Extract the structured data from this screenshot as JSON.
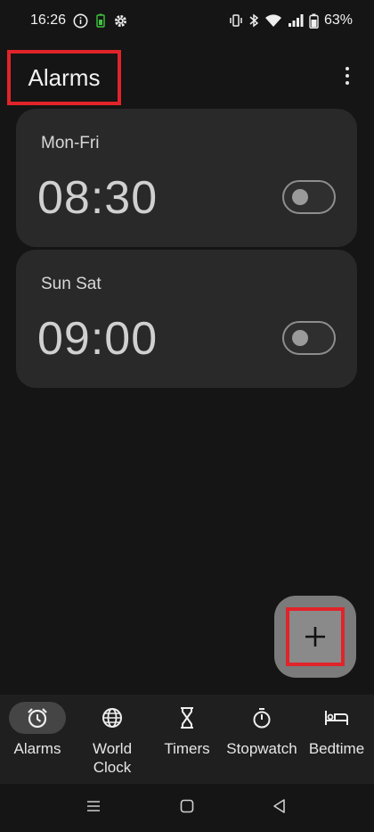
{
  "status_bar": {
    "time": "16:26",
    "battery_percent": "63%",
    "icons_left": [
      "info-icon",
      "battery-saver-icon",
      "settings-gear-icon"
    ],
    "icons_right": [
      "vibrate-icon",
      "bluetooth-icon",
      "wifi-icon",
      "signal-icon",
      "battery-icon"
    ]
  },
  "app_bar": {
    "title": "Alarms",
    "menu_icon": "more-vert-icon"
  },
  "alarms": [
    {
      "days": "Mon-Fri",
      "time": "08:30",
      "enabled": false
    },
    {
      "days": "Sun Sat",
      "time": "09:00",
      "enabled": false
    }
  ],
  "fab": {
    "icon": "plus-icon"
  },
  "bottom_nav": {
    "items": [
      {
        "label": "Alarms",
        "icon": "alarm-clock-icon",
        "active": true
      },
      {
        "label": "World Clock",
        "icon": "globe-icon",
        "active": false
      },
      {
        "label": "Timers",
        "icon": "hourglass-icon",
        "active": false
      },
      {
        "label": "Stopwatch",
        "icon": "stopwatch-icon",
        "active": false
      },
      {
        "label": "Bedtime",
        "icon": "bed-icon",
        "active": false
      }
    ]
  },
  "system_nav": [
    "recents-icon",
    "home-icon",
    "back-icon"
  ],
  "colors": {
    "background": "#151515",
    "card": "#292929",
    "highlight_box": "#e0242a",
    "fab": "#8a8a8a"
  }
}
